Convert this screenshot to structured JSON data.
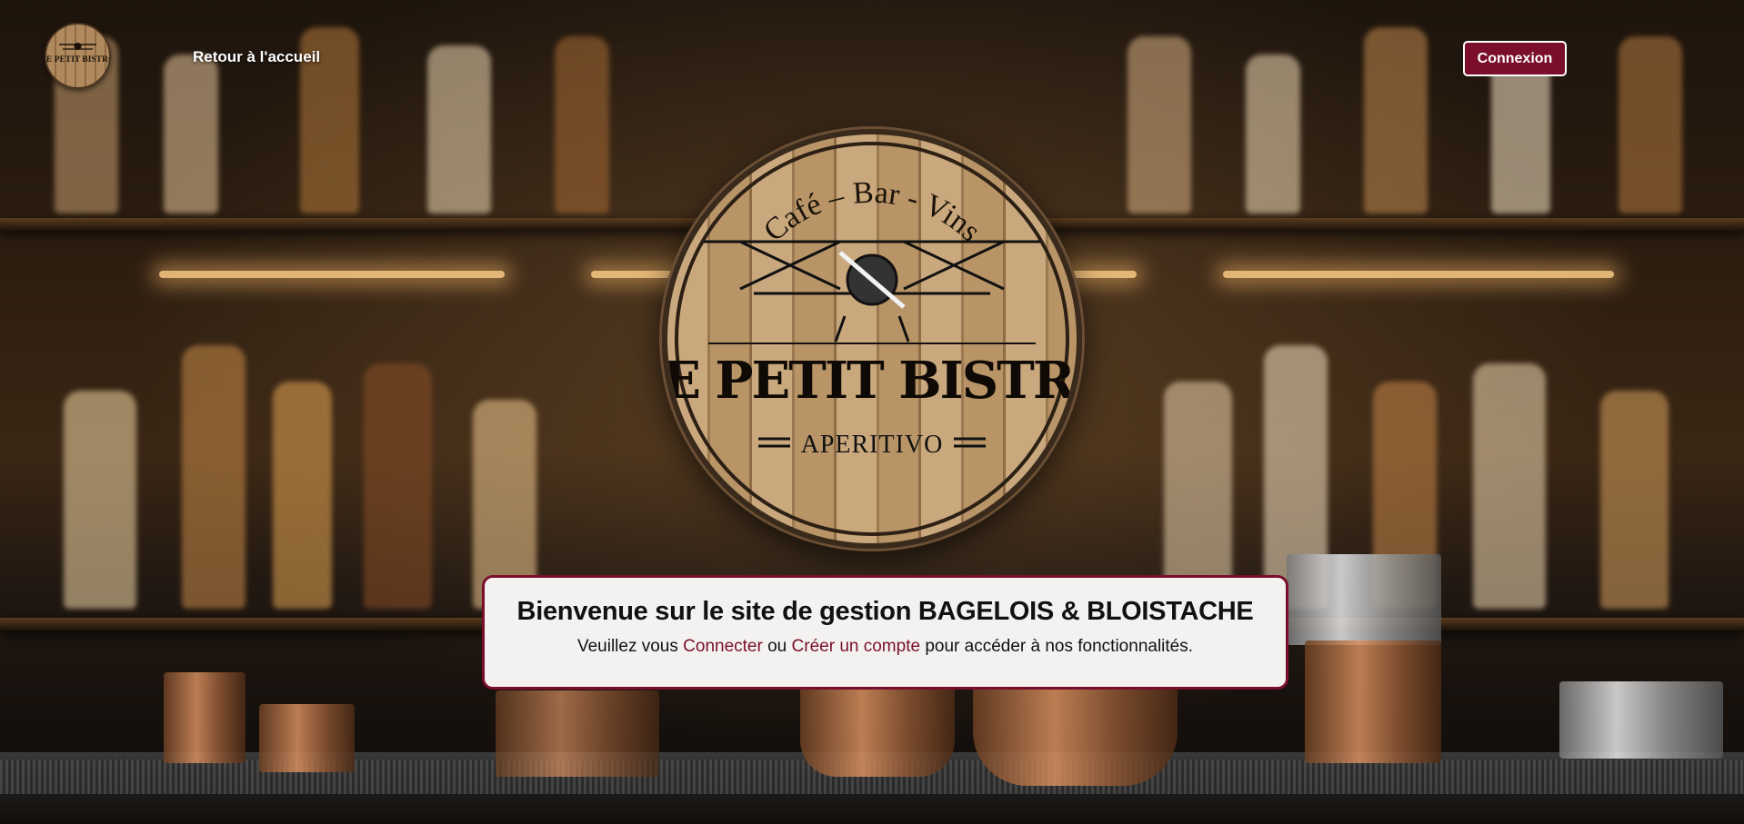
{
  "header": {
    "home_link": "Retour à l'accueil",
    "login_button": "Connexion",
    "logo_small_text": "LE PETIT BISTRO"
  },
  "hero_logo": {
    "top_text": "Café – Bar - Vins",
    "brand_name": "LE PETIT BISTRO",
    "sub_text": "APERITIVO"
  },
  "welcome": {
    "title": "Bienvenue sur le site de gestion BAGELOIS & BLOISTACHE",
    "text_before": "Veuillez vous",
    "link_login": "Connecter",
    "text_or": "ou",
    "link_signup": "Créer un compte",
    "text_after": "pour accéder à nos fonctionnalités."
  },
  "colors": {
    "accent": "#7a0e2b",
    "card_background": "#f4f2f1",
    "text": "#111111",
    "header_text": "#ffffff"
  },
  "icons": [
    "bistro-logo-icon",
    "biplane-icon"
  ]
}
